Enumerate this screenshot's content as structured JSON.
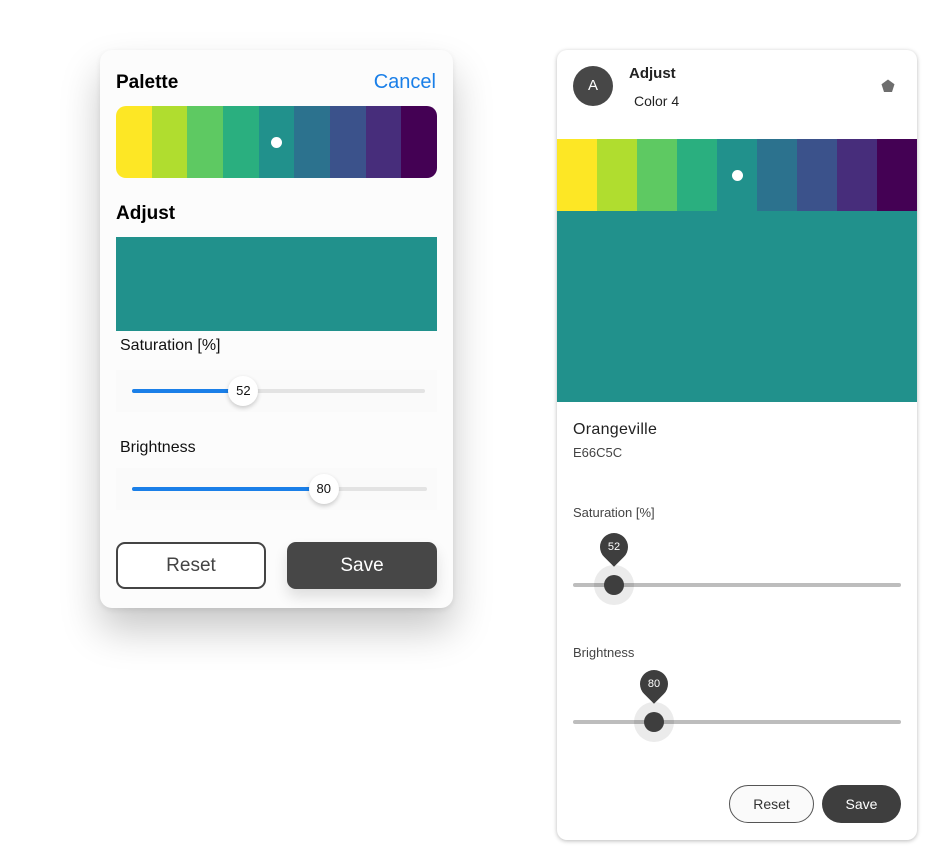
{
  "palette": {
    "swatches": [
      "#FDE725",
      "#B0DD2F",
      "#5EC962",
      "#2AAF7F",
      "#21918C",
      "#2C728E",
      "#3B528B",
      "#472D7B",
      "#440154"
    ],
    "selected_index": 4,
    "selected_color": "#21918C"
  },
  "left_panel": {
    "title": "Palette",
    "cancel_label": "Cancel",
    "adjust_title": "Adjust",
    "saturation_label": "Saturation [%]",
    "saturation_value": "52",
    "saturation_fraction": 0.38,
    "brightness_label": "Brightness",
    "brightness_value": "80",
    "brightness_fraction": 0.65,
    "reset_label": "Reset",
    "save_label": "Save",
    "accent_color": "#1A7FE8"
  },
  "right_panel": {
    "avatar_letter": "A",
    "title": "Adjust",
    "subtitle": "Color 4",
    "menu_icon": "pentagon-icon",
    "color_name": "Orangeville",
    "color_hex": "E66C5C",
    "saturation_label": "Saturation [%]",
    "saturation_value": "52",
    "saturation_fraction": 0.125,
    "brightness_label": "Brightness",
    "brightness_value": "80",
    "brightness_fraction": 0.247,
    "reset_label": "Reset",
    "save_label": "Save"
  }
}
